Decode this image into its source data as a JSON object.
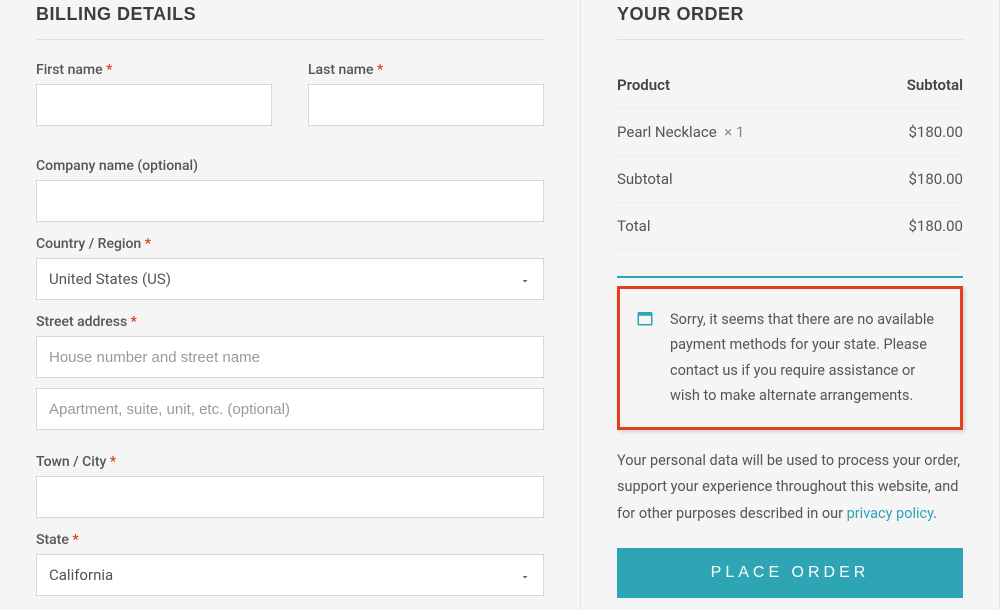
{
  "billing": {
    "heading": "BILLING DETAILS",
    "first_name_label": "First name",
    "last_name_label": "Last name",
    "company_label": "Company name (optional)",
    "country_label": "Country / Region",
    "country_value": "United States (US)",
    "street_label": "Street address",
    "street_placeholder_1": "House number and street name",
    "street_placeholder_2": "Apartment, suite, unit, etc. (optional)",
    "town_label": "Town / City",
    "state_label": "State",
    "state_value": "California"
  },
  "order": {
    "heading": "YOUR ORDER",
    "product_header": "Product",
    "subtotal_header": "Subtotal",
    "line_item_name": "Pearl Necklace",
    "line_item_qty": "× 1",
    "line_item_price": "$180.00",
    "subtotal_label": "Subtotal",
    "subtotal_value": "$180.00",
    "total_label": "Total",
    "total_value": "$180.00",
    "error_message": "Sorry, it seems that there are no available payment methods for your state. Please contact us if you require assistance or wish to make alternate arrangements.",
    "privacy_text": "Your personal data will be used to process your order, support your experience throughout this website, and for other purposes described in our ",
    "privacy_link": "privacy policy",
    "privacy_suffix": ".",
    "place_order_label": "PLACE ORDER"
  },
  "required_marker": "*"
}
